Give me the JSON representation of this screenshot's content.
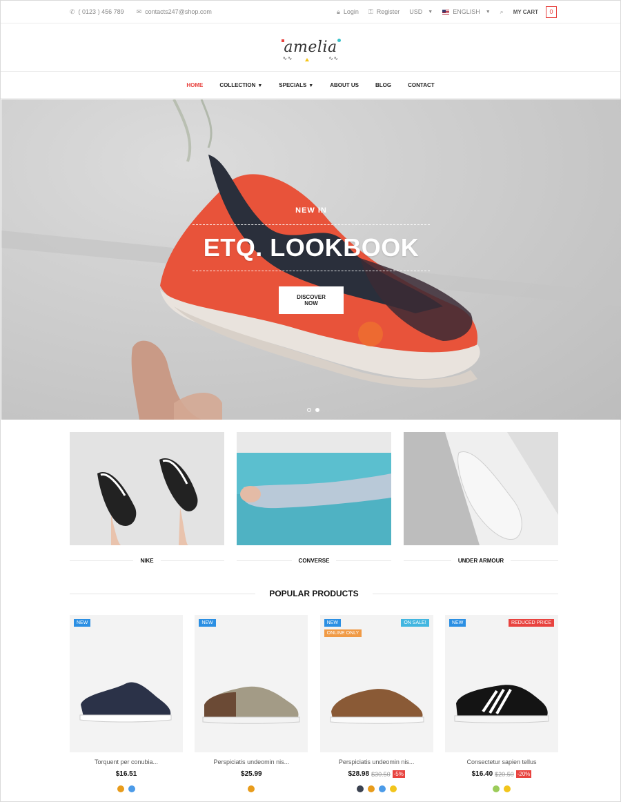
{
  "topbar": {
    "phone": "( 0123 ) 456 789",
    "email": "contacts247@shop.com",
    "login": "Login",
    "register": "Register",
    "currency": "USD",
    "language": "ENGLISH",
    "cart_label": "MY CART",
    "cart_count": "0"
  },
  "logo": {
    "text": "amelia"
  },
  "nav": {
    "items": [
      {
        "label": "HOME"
      },
      {
        "label": "COLLECTION"
      },
      {
        "label": "SPECIALS"
      },
      {
        "label": "ABOUT US"
      },
      {
        "label": "BLOG"
      },
      {
        "label": "CONTACT"
      }
    ]
  },
  "hero": {
    "kicker": "NEW IN",
    "headline": "ETQ. LOOKBOOK",
    "cta": "DISCOVER NOW"
  },
  "categories": [
    {
      "label": "NIKE"
    },
    {
      "label": "CONVERSE"
    },
    {
      "label": "UNDER ARMOUR"
    }
  ],
  "popular": {
    "title": "POPULAR PRODUCTS",
    "products": [
      {
        "badge_new": "NEW",
        "name": "Torquent per conubia...",
        "price": "$16.51",
        "swatches": [
          "#e89c1c",
          "#4c9be8"
        ]
      },
      {
        "badge_new": "NEW",
        "name": "Perspiciatis undeomin nis...",
        "price": "$25.99",
        "swatches": [
          "#e89c1c"
        ]
      },
      {
        "badge_new": "NEW",
        "badge_sale": "ON SALE!",
        "badge_online": "ONLINE ONLY",
        "name": "Perspiciatis undeomin nis...",
        "price": "$28.98",
        "old_price": "$30.50",
        "discount": "-5%",
        "swatches": [
          "#3b4250",
          "#e89c1c",
          "#4c9be8",
          "#f2c51c"
        ]
      },
      {
        "badge_new": "NEW",
        "badge_reduced": "REDUCED PRICE",
        "name": "Consectetur sapien tellus",
        "price": "$16.40",
        "old_price": "$20.50",
        "discount": "-20%",
        "swatches": [
          "#9ccc5a",
          "#f2c51c"
        ]
      }
    ]
  }
}
